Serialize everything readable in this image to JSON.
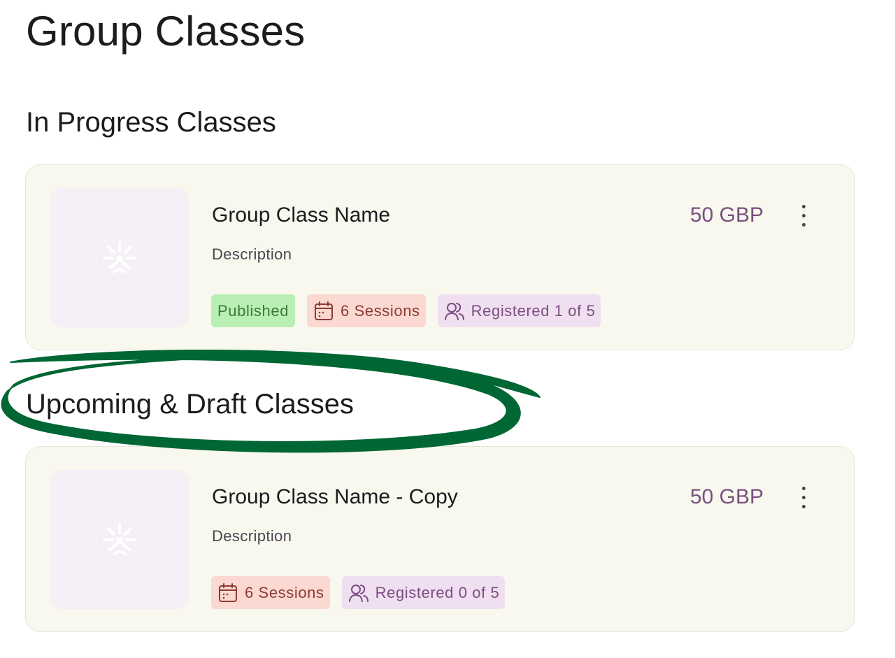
{
  "page": {
    "title": "Group Classes"
  },
  "sections": {
    "in_progress": {
      "title": "In Progress Classes",
      "card": {
        "name": "Group Class Name",
        "description": "Description",
        "price": "50 GBP",
        "status": "Published",
        "sessions": "6 Sessions",
        "registered": "Registered 1 of 5"
      }
    },
    "upcoming": {
      "title": "Upcoming & Draft Classes",
      "card": {
        "name": "Group Class Name - Copy",
        "description": "Description",
        "price": "50 GBP",
        "sessions": "6 Sessions",
        "registered": "Registered 0 of 5"
      }
    }
  },
  "icons": {
    "thumbnail": "placeholder-logo-icon",
    "more": "more-vertical-icon",
    "sessions": "calendar-icon",
    "registered": "users-icon"
  },
  "colors": {
    "card_bg": "#f8f8ee",
    "price": "#7a4f80",
    "published_bg": "#b9efb4",
    "published_fg": "#3b7a3b",
    "sessions_bg": "#fbd8d2",
    "sessions_fg": "#8c3b33",
    "registered_bg": "#f0dff1",
    "registered_fg": "#7a4f80",
    "annotation": "#006633"
  }
}
